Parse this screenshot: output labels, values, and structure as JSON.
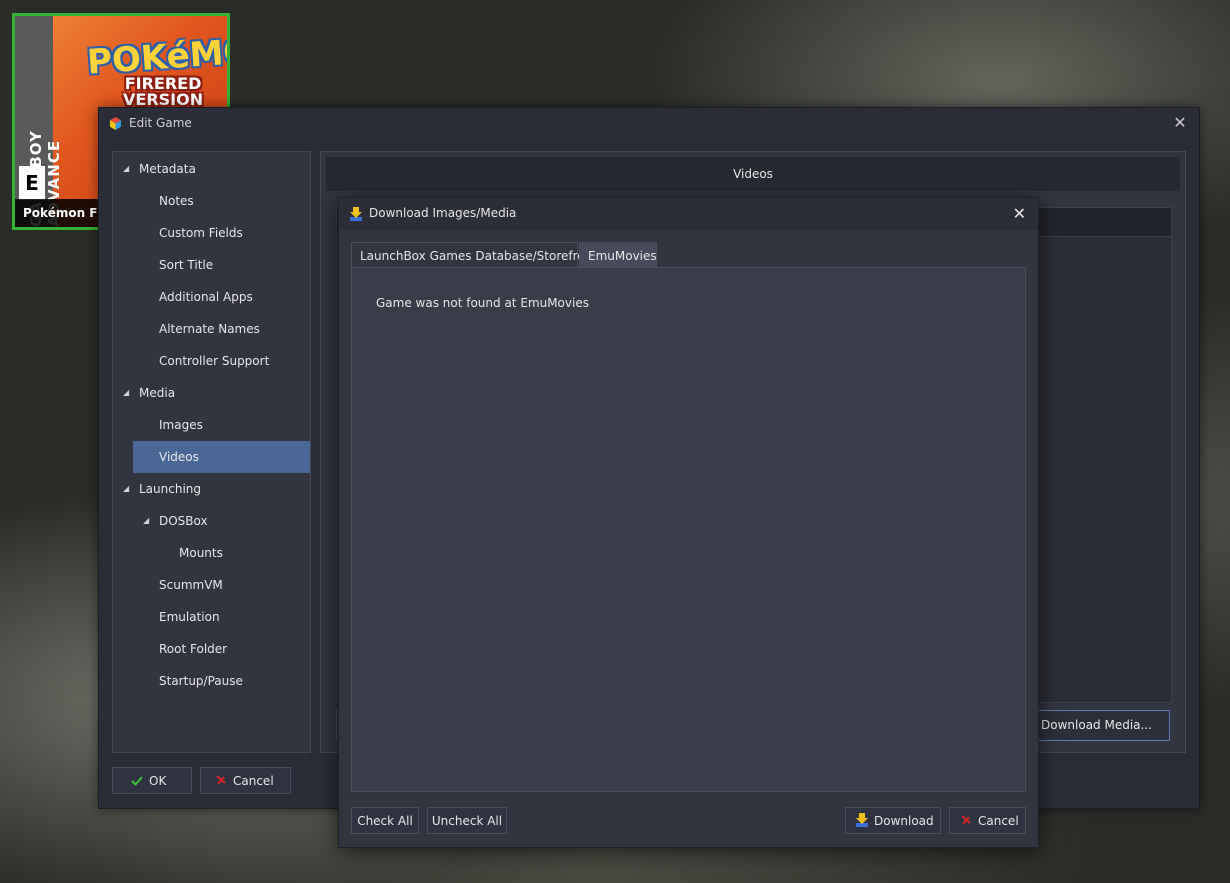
{
  "game_tile": {
    "caption": "Pokémon Fire",
    "art_logo": "POKéMON",
    "art_subtitle_1": "FIRERED",
    "art_subtitle_2": "VERSION",
    "art_console": "GAME BOY ADVANCE",
    "art_rating": "E"
  },
  "edit_game": {
    "title": "Edit Game",
    "nav": {
      "metadata": "Metadata",
      "notes": "Notes",
      "custom_fields": "Custom Fields",
      "sort_title": "Sort Title",
      "additional_apps": "Additional Apps",
      "alternate_names": "Alternate Names",
      "controller_support": "Controller Support",
      "media": "Media",
      "images": "Images",
      "videos": "Videos",
      "launching": "Launching",
      "dosbox": "DOSBox",
      "mounts": "Mounts",
      "scummvm": "ScummVM",
      "emulation": "Emulation",
      "root_folder": "Root Folder",
      "startup_pause": "Startup/Pause"
    },
    "content_header": "Videos",
    "download_media": "Download Media...",
    "ok": "OK",
    "cancel": "Cancel"
  },
  "download_dialog": {
    "title": "Download Images/Media",
    "tabs": {
      "launchbox": "LaunchBox Games Database/Storefronts",
      "emumovies": "EmuMovies"
    },
    "message": "Game was not found at EmuMovies",
    "check_all": "Check All",
    "uncheck_all": "Uncheck All",
    "download": "Download",
    "cancel": "Cancel"
  },
  "colors": {
    "selection": "#4a6796",
    "tile_border": "#35b233",
    "window_bg": "#2a2c37",
    "panel_bg": "#32343f"
  }
}
